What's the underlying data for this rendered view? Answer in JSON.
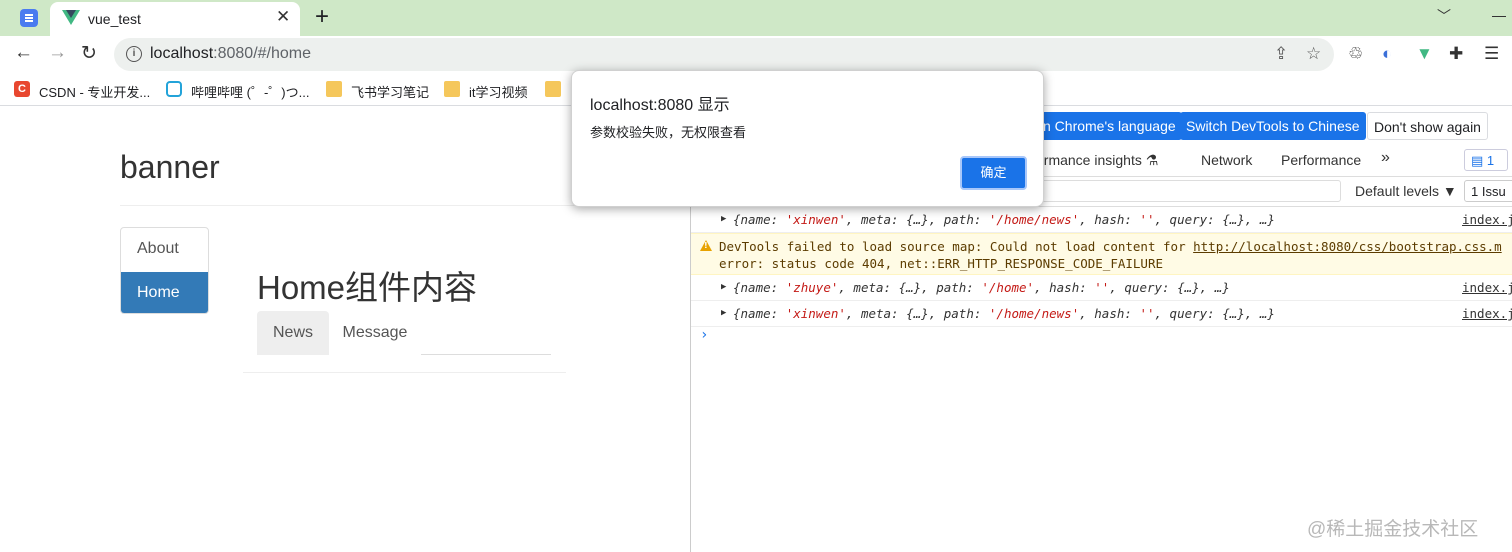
{
  "browser": {
    "tabs": [
      {
        "label": "",
        "icon": "docs-icon"
      },
      {
        "label": "vue_test",
        "icon": "vue-logo-icon",
        "active": true
      }
    ],
    "close_glyph": "✕",
    "new_tab_glyph": "+",
    "url_host": "localhost",
    "url_rest": ":8080/#/home",
    "bookmarks": [
      {
        "label": "CSDN - 专业开发...",
        "icon": "csdn-icon"
      },
      {
        "label": "哔哩哔哩 (゜-゜)つ...",
        "icon": "bilibili-icon"
      },
      {
        "label": "飞书学习笔记",
        "icon": "folder-icon"
      },
      {
        "label": "it学习视频",
        "icon": "folder-icon"
      }
    ]
  },
  "page": {
    "banner": "banner",
    "side_nav": [
      {
        "label": "About",
        "active": false
      },
      {
        "label": "Home",
        "active": true
      }
    ],
    "home_title": "Home组件内容",
    "sub_tabs": [
      {
        "label": "News",
        "active": true
      },
      {
        "label": "Message",
        "active": false
      }
    ]
  },
  "devtools": {
    "infobar": {
      "lang_btn": "n Chrome's language",
      "switch_btn": "Switch DevTools to Chinese",
      "dont_show_btn": "Don't show again"
    },
    "tabs": [
      "ormance insights",
      "Network",
      "Performance"
    ],
    "more_tabs": "»",
    "message_badge": "1",
    "levels": "Default levels ▼",
    "issues": "1 Issu",
    "logs": [
      {
        "prefix": "{name: ",
        "name": "'xinwen'",
        "mid": ", meta: {…}, path: ",
        "path": "'/home/news'",
        "mid2": ", hash: ",
        "hash": "''",
        "tail": ", query: {…}, …}",
        "src": "index.j"
      },
      {
        "prefix": "{name: ",
        "name": "'zhuye'",
        "mid": ", meta: {…}, path: ",
        "path": "'/home'",
        "mid2": ", hash: ",
        "hash": "''",
        "tail": ", query: {…}, …}",
        "src": "index.j"
      },
      {
        "prefix": "{name: ",
        "name": "'xinwen'",
        "mid": ", meta: {…}, path: ",
        "path": "'/home/news'",
        "mid2": ", hash: ",
        "hash": "''",
        "tail": ", query: {…}, …}",
        "src": "index.j"
      }
    ],
    "warning": {
      "line1": "DevTools failed to load source map: Could not load content for ",
      "link": "http://localhost:8080/css/bootstrap.css.m",
      "line2": "error: status code 404, net::ERR_HTTP_RESPONSE_CODE_FAILURE"
    },
    "prompt": "›"
  },
  "dialog": {
    "title": "localhost:8080 显示",
    "message": "参数校验失败，无权限查看",
    "ok_label": "确定"
  },
  "watermark": "@稀土掘金技术社区",
  "colors": {
    "tabstrip": "#cfe8c7",
    "active_nav": "#337ab7",
    "devtools_blue": "#1a73e8",
    "string_red": "#c41a16",
    "warning_bg": "#fffbe5"
  }
}
